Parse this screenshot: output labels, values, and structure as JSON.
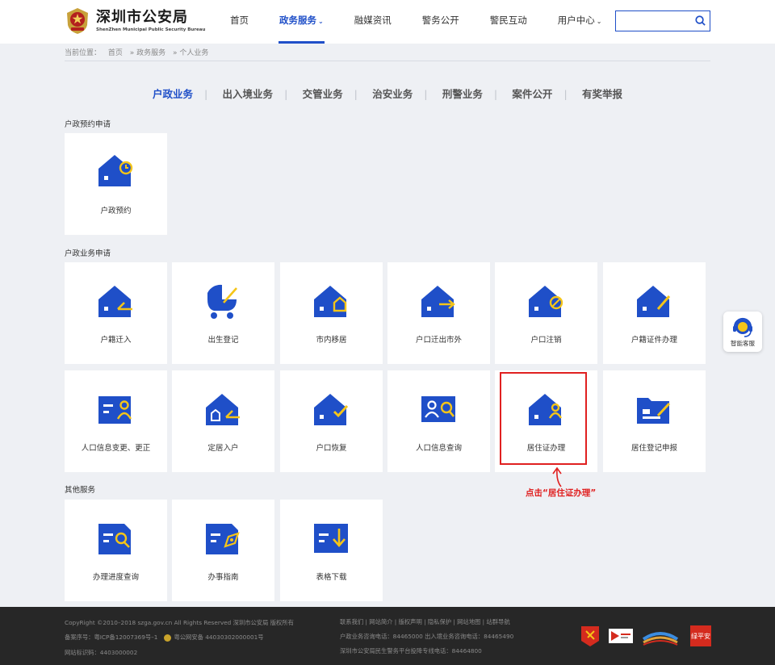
{
  "header": {
    "logo_cn": "深圳市公安局",
    "logo_en": "ShenZhen Municipal Public Security Bureau",
    "nav": [
      {
        "label": "首页",
        "caret": ""
      },
      {
        "label": "政务服务",
        "caret": "⌄"
      },
      {
        "label": "融媒资讯",
        "caret": ""
      },
      {
        "label": "警务公开",
        "caret": ""
      },
      {
        "label": "警民互动",
        "caret": ""
      },
      {
        "label": "用户中心",
        "caret": "⌄"
      }
    ],
    "active_nav": "政务服务",
    "search_placeholder": "",
    "search_icon": "search-icon",
    "accent_color": "#1f4fc8"
  },
  "breadcrumb": {
    "prefix": "当前位置：",
    "items": [
      "首页",
      "» 政务服务",
      "» 个人业务"
    ]
  },
  "tabs": [
    "户政业务",
    "出入境业务",
    "交管业务",
    "治安业务",
    "刑警业务",
    "案件公开",
    "有奖举报"
  ],
  "tab_separator": "|",
  "sections": {
    "booking": {
      "title": "户政预约申请",
      "items": [
        "户政预约"
      ]
    },
    "apply": {
      "title": "户政业务申请",
      "items": [
        "户籍迁入",
        "出生登记",
        "市内移居",
        "户口迁出市外",
        "户口注销",
        "户籍证件办理",
        "人口信息变更、更正",
        "定居入户",
        "户口恢复",
        "人口信息查询",
        "居住证办理",
        "居住登记申报"
      ]
    },
    "other": {
      "title": "其他服务",
      "items": [
        "办理进度查询",
        "办事指南",
        "表格下载"
      ]
    }
  },
  "annotation": "点击“居住证办理”",
  "annotation_color": "#e02020",
  "float_service": {
    "label": "智能客服",
    "icon": "headset-icon"
  },
  "footer": {
    "copyright": "CopyRight ©2010–2018 szga.gov.cn All Rights Reserved 深圳市公安局 版权所有",
    "icp": "备案序号：粤ICP备12007369号–1",
    "police_record": "粤公网安备 44030302000001号",
    "site_id": "网站标识码：4403000002",
    "links": "联系我们 | 网站简介 | 版权声明 | 隐私保护 | 网站地图 | 站群导航",
    "hotline1": "户政业务咨询电话：84465000 出入境业务咨询电话：84465490",
    "hotline2": "深圳市公安局民生警务平台投降专线电话：84464800",
    "badge4_text": "绿平安"
  }
}
